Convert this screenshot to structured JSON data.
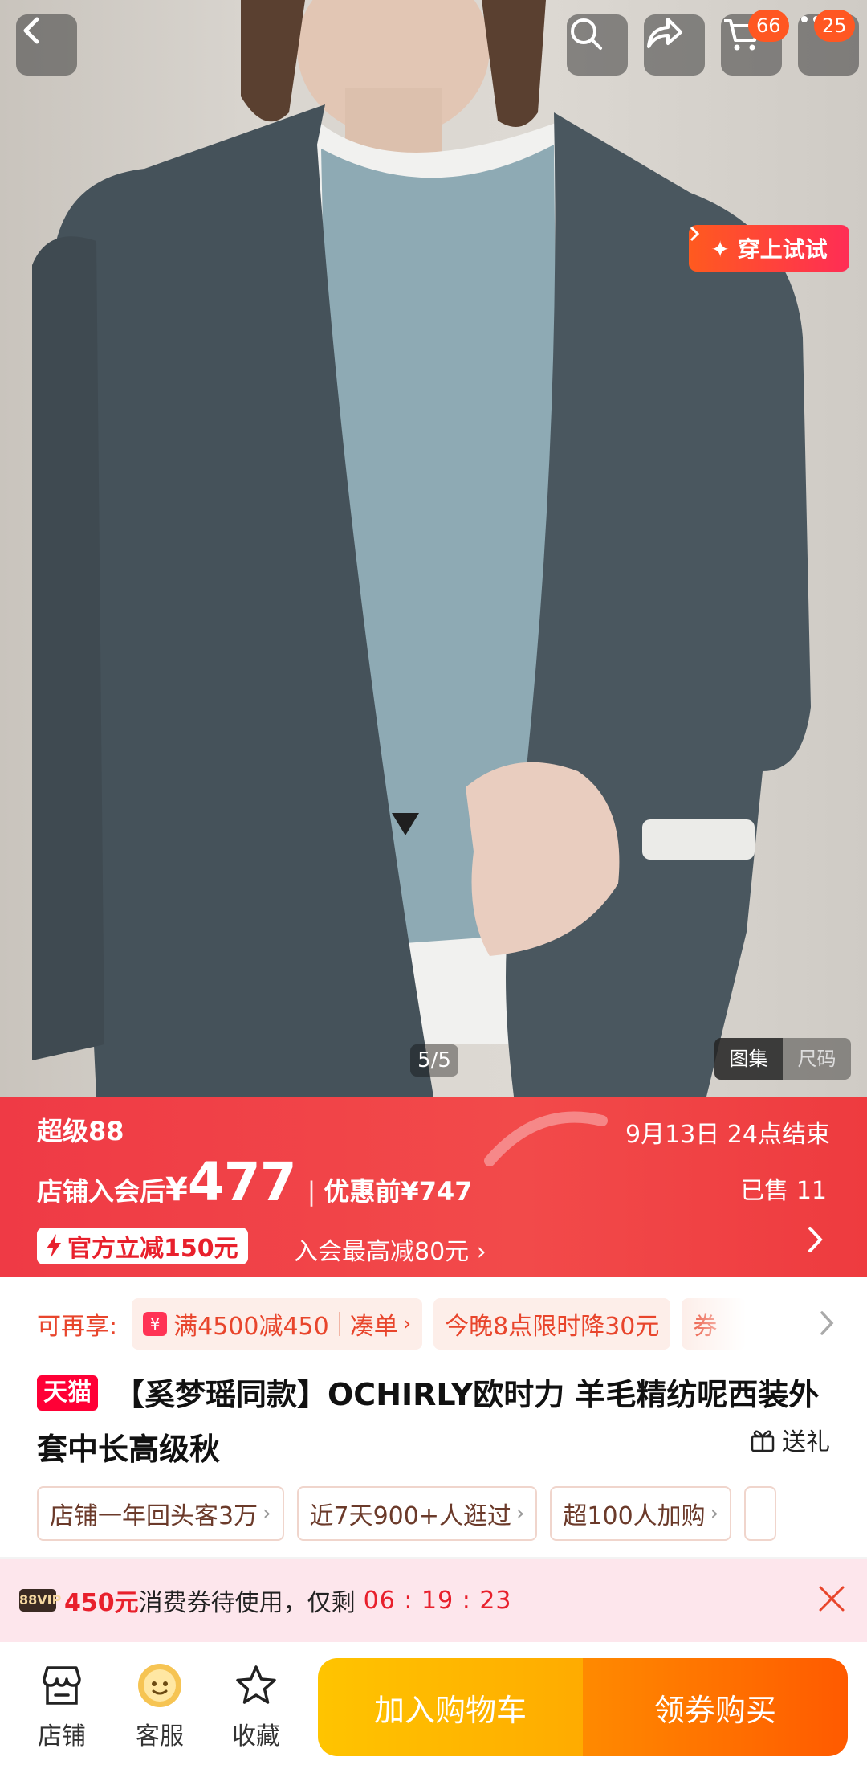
{
  "header": {
    "cart_badge": "66",
    "more_badge": "25"
  },
  "gallery": {
    "try_on_label": "✦ 穿上试试",
    "counter": "5/5",
    "view_tabs": [
      "图集",
      "尺码"
    ]
  },
  "promo": {
    "event": "超级88",
    "ends": "9月13日 24点结束",
    "price_prefix": "店铺入会后",
    "currency": "¥",
    "price": "477",
    "separator": "|",
    "original_price": "优惠前¥747",
    "sold": "已售 11",
    "official_cut": "官方立减150元",
    "member_text": "入会最高减80元",
    "member_chevron": "›"
  },
  "benefits": {
    "label": "可再享:",
    "coupon_icon": "¥",
    "threshold": "满4500减450",
    "bundle": "凑单",
    "tonight": "今晚8点限时降30元",
    "more": "券"
  },
  "product": {
    "store_badge": "天猫",
    "title": "【奚梦瑶同款】OCHIRLY欧时力 羊毛精纺呢西装外套中长高级秋",
    "gift": "送礼"
  },
  "tags": [
    {
      "label": "店铺一年回头客3万"
    },
    {
      "label": "近7天900+人逛过"
    },
    {
      "label": "超100人加购"
    }
  ],
  "tag_arrow": "›",
  "coupon": {
    "vip": "88VIP",
    "amount": "450元",
    "text": "消费券待使用，仅剩",
    "timer": "06 : 19 : 23"
  },
  "bottom": {
    "shop": "店铺",
    "service": "客服",
    "favorite": "收藏",
    "add_to_cart": "加入购物车",
    "buy": "领券购买"
  },
  "colors": {
    "promo_red": "#ef3a45",
    "cart_yellow": "#ffc400",
    "buy_orange": "#ff6a00",
    "tmall_red": "#ff0036"
  }
}
